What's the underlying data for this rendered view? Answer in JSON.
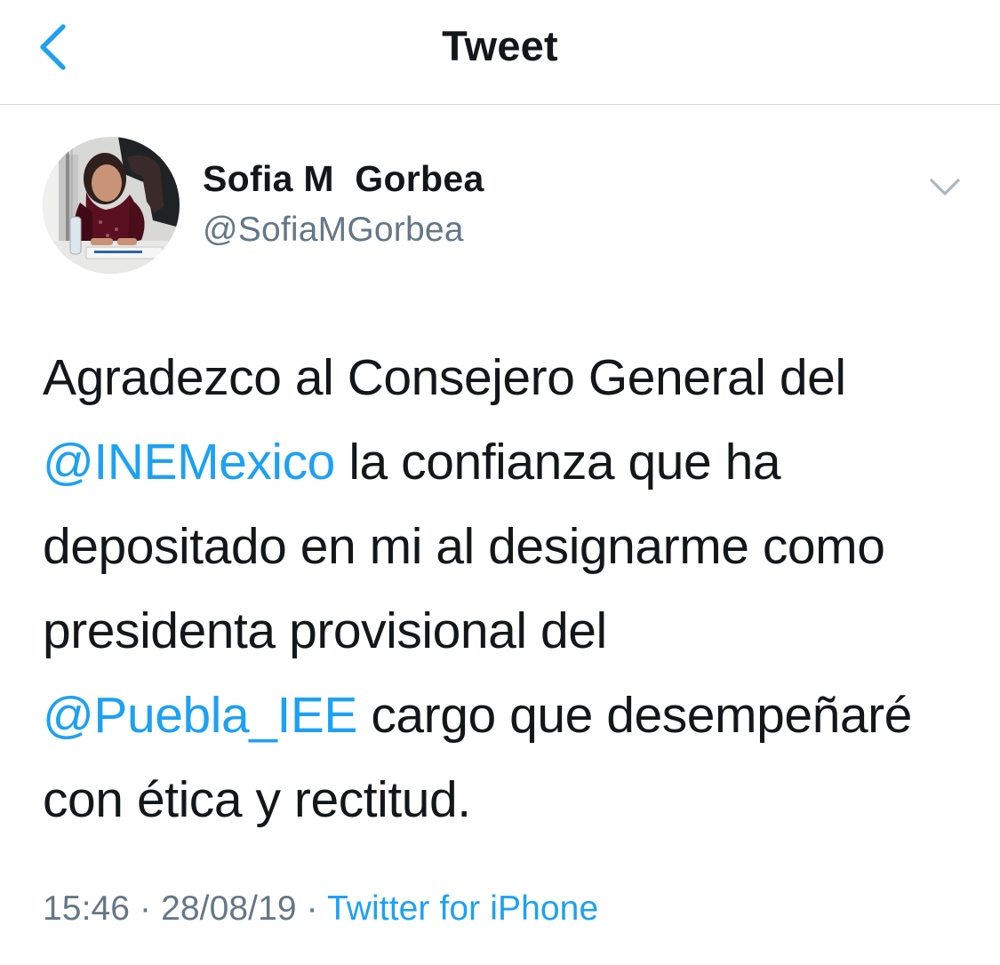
{
  "nav": {
    "title": "Tweet",
    "back_icon": "chevron-left-icon"
  },
  "colors": {
    "link": "#1da1f2",
    "primary_text": "#14171a",
    "secondary_text": "#657786",
    "divider": "#d6d9dc"
  },
  "tweet": {
    "author": {
      "name": "Sofia M  Gorbea",
      "handle": "@SofiaMGorbea",
      "avatar_icon": "profile-photo"
    },
    "menu_icon": "chevron-down-icon",
    "text": {
      "line_1": "Agradezco al Consejero General del",
      "line_2_mention": "@INEMexico",
      "line_2_rest": " la confianza que ha",
      "line_3": "depositado en mi al designarme como",
      "line_4": "presidenta provisional del",
      "line_5_mention": "@Puebla_IEE",
      "line_5_rest": " cargo que desempeñaré",
      "line_6": "con ética y rectitud."
    },
    "meta": {
      "time": "15:46",
      "separator_1": " · ",
      "date": "28/08/19",
      "separator_2": " · ",
      "source": "Twitter for iPhone"
    }
  }
}
